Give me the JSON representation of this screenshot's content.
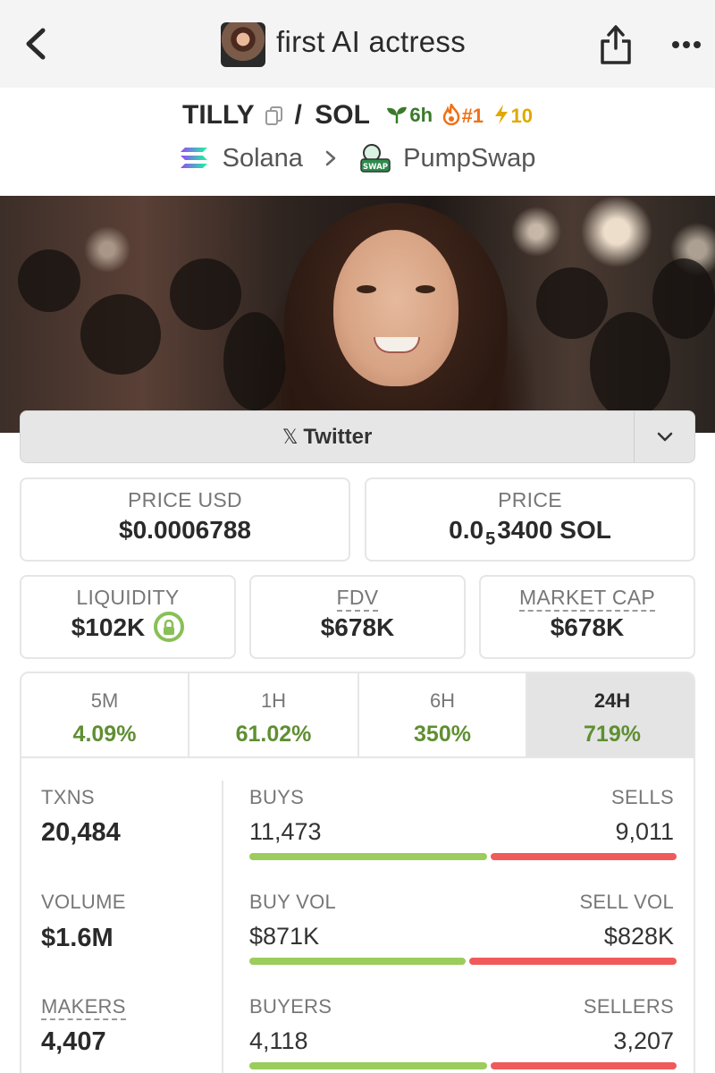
{
  "header": {
    "title": "first AI actress"
  },
  "pair": {
    "base": "TILLY",
    "separator": "/",
    "quote": "SOL",
    "age": "6h",
    "rank": "#1",
    "boosts": "10",
    "chain": "Solana",
    "dex": "PumpSwap",
    "dex_logo_text": "SWAP"
  },
  "socials": {
    "twitter_label": "Twitter",
    "x_glyph": "𝕏"
  },
  "prices": {
    "price_usd_label": "PRICE USD",
    "price_usd": "$0.0006788",
    "price_label": "PRICE",
    "price_native_lead": "0.0",
    "price_native_subscript": "5",
    "price_native_tail": "3400 SOL"
  },
  "metrics": {
    "liquidity_label": "LIQUIDITY",
    "liquidity": "$102K",
    "fdv_label": "FDV",
    "fdv": "$678K",
    "mcap_label": "MARKET CAP",
    "mcap": "$678K"
  },
  "timeframes": [
    {
      "label": "5M",
      "change": "4.09%"
    },
    {
      "label": "1H",
      "change": "61.02%"
    },
    {
      "label": "6H",
      "change": "350%"
    },
    {
      "label": "24H",
      "change": "719%",
      "active": true
    }
  ],
  "stats": {
    "txns_label": "TXNS",
    "txns": "20,484",
    "volume_label": "VOLUME",
    "volume": "$1.6M",
    "makers_label": "MAKERS",
    "makers": "4,407",
    "buys_label": "BUYS",
    "buys": "11,473",
    "sells_label": "SELLS",
    "sells": "9,011",
    "buys_fraction": 0.56,
    "buy_vol_label": "BUY VOL",
    "buy_vol": "$871K",
    "sell_vol_label": "SELL VOL",
    "sell_vol": "$828K",
    "buy_vol_fraction": 0.51,
    "buyers_label": "BUYERS",
    "buyers": "4,118",
    "sellers_label": "SELLERS",
    "sellers": "3,207",
    "buyers_fraction": 0.56
  },
  "colors": {
    "positive": "#5f8f32",
    "buy_bar": "#9bcc5c",
    "sell_bar": "#ef5b5b",
    "rank": "#f07016",
    "boost": "#e0a800",
    "age": "#3a7a2a"
  }
}
